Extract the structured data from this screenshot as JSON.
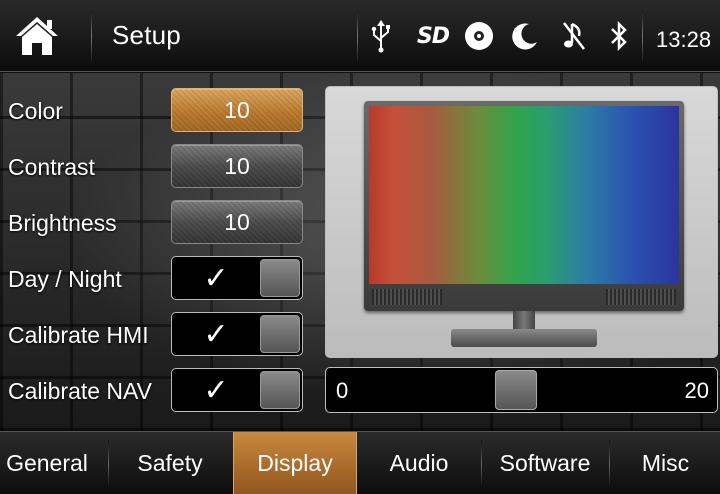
{
  "header": {
    "title": "Setup",
    "clock": "13:28",
    "home_icon": "home-icon",
    "status_icons": [
      "usb-icon",
      "sd-card-icon",
      "disc-icon",
      "night-mode-icon",
      "mute-music-icon",
      "bluetooth-icon"
    ],
    "sd_label": "SD"
  },
  "settings": {
    "color": {
      "label": "Color",
      "value": "10"
    },
    "contrast": {
      "label": "Contrast",
      "value": "10"
    },
    "brightness": {
      "label": "Brightness",
      "value": "10"
    },
    "day_night": {
      "label": "Day / Night",
      "checked": true,
      "mark": "✓"
    },
    "calibrate_hmi": {
      "label": "Calibrate HMI",
      "checked": true,
      "mark": "✓"
    },
    "calibrate_nav": {
      "label": "Calibrate NAV",
      "checked": true,
      "mark": "✓"
    }
  },
  "slider": {
    "min": "0",
    "max": "20",
    "value": 10
  },
  "tabs": [
    {
      "label": "General",
      "active": false
    },
    {
      "label": "Safety",
      "active": false
    },
    {
      "label": "Display",
      "active": true
    },
    {
      "label": "Audio",
      "active": false
    },
    {
      "label": "Software",
      "active": false
    },
    {
      "label": "Misc",
      "active": false
    }
  ],
  "colors": {
    "accent": "#b9782d",
    "text": "#ffffff",
    "panel_border": "#bdbdbd"
  }
}
